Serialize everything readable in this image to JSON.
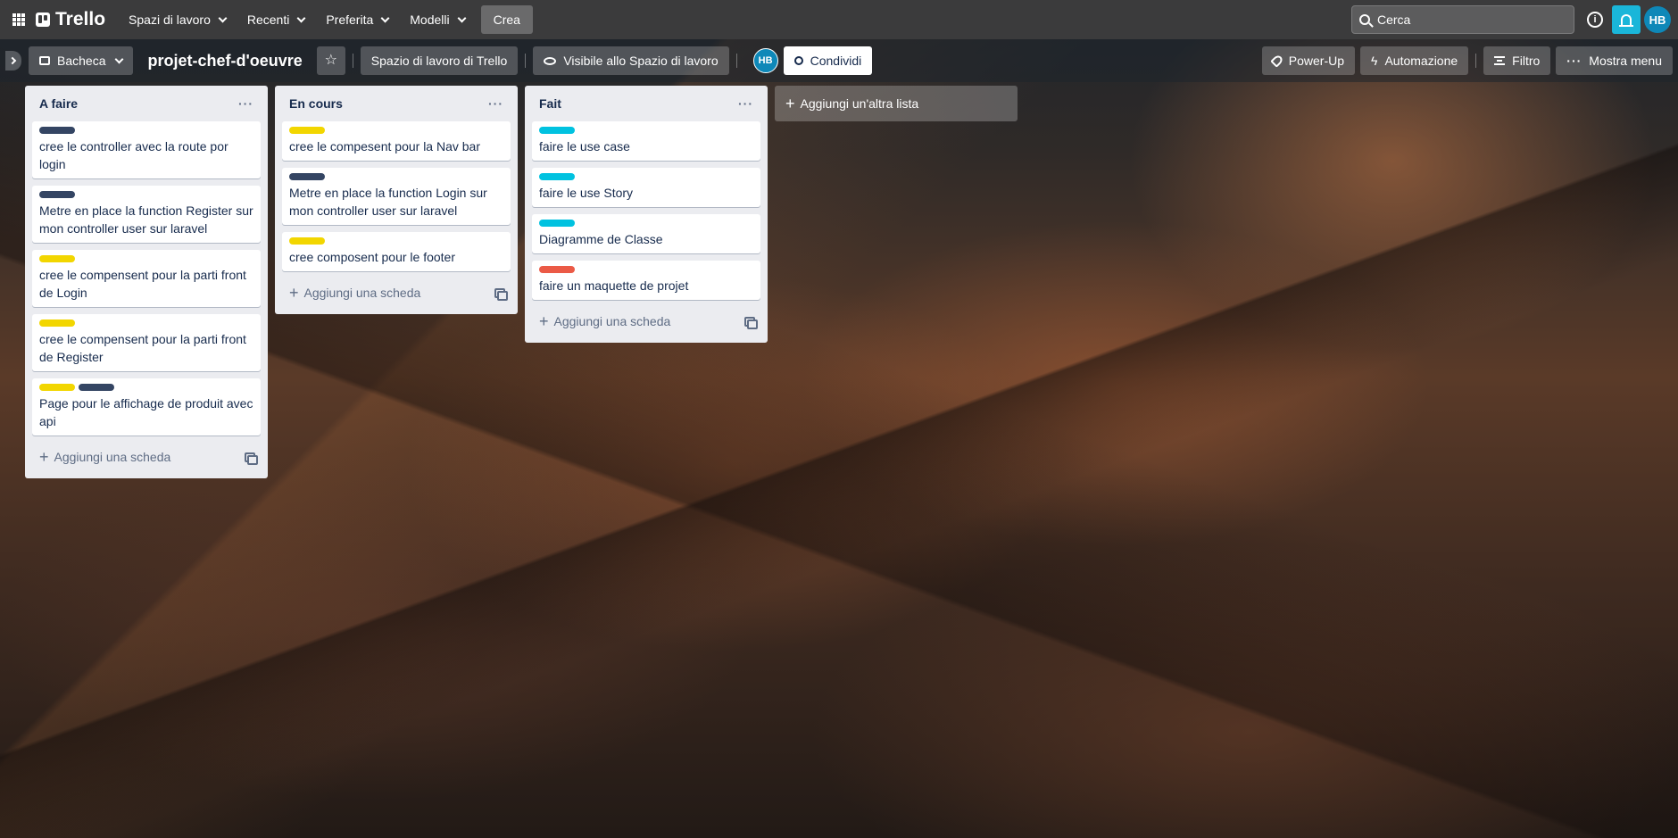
{
  "topnav": {
    "app_name": "Trello",
    "menus": [
      {
        "label": "Spazi di lavoro"
      },
      {
        "label": "Recenti"
      },
      {
        "label": "Preferita"
      },
      {
        "label": "Modelli"
      }
    ],
    "create_label": "Crea",
    "search_placeholder": "Cerca",
    "info_glyph": "i",
    "avatar_initials": "HB"
  },
  "boardbar": {
    "view_label": "Bacheca",
    "board_title": "projet-chef-d'oeuvre",
    "star_glyph": "☆",
    "workspace_label": "Spazio di lavoro di Trello",
    "visibility_label": "Visibile allo Spazio di lavoro",
    "member_initials": "HB",
    "share_label": "Condividi",
    "powerup_label": "Power-Up",
    "automation_label": "Automazione",
    "automation_glyph": "ϟ",
    "filter_label": "Filtro",
    "menu_label": "Mostra menu",
    "menu_dots": "···"
  },
  "label_colors": {
    "dark": "#344563",
    "yellow": "#f2d600",
    "cyan": "#00c2e0",
    "red": "#eb5a46"
  },
  "lists": [
    {
      "title": "A faire",
      "menu": "···",
      "add_card_label": "Aggiungi una scheda",
      "cards": [
        {
          "labels": [
            "dark"
          ],
          "text": "cree le controller avec la route por login"
        },
        {
          "labels": [
            "dark"
          ],
          "text": "Metre en place la function Register sur mon controller user sur laravel"
        },
        {
          "labels": [
            "yellow"
          ],
          "text": "cree le compensent pour la parti front de Login"
        },
        {
          "labels": [
            "yellow"
          ],
          "text": "cree le compensent pour la parti front de Register"
        },
        {
          "labels": [
            "yellow",
            "dark"
          ],
          "text": "Page pour le affichage de produit avec api"
        }
      ]
    },
    {
      "title": "En cours",
      "menu": "···",
      "add_card_label": "Aggiungi una scheda",
      "cards": [
        {
          "labels": [
            "yellow"
          ],
          "text": "cree le compesent pour la Nav bar"
        },
        {
          "labels": [
            "dark"
          ],
          "text": "Metre en place la function Login sur mon controller user sur laravel"
        },
        {
          "labels": [
            "yellow"
          ],
          "text": "cree composent pour le footer"
        }
      ]
    },
    {
      "title": "Fait",
      "menu": "···",
      "add_card_label": "Aggiungi una scheda",
      "cards": [
        {
          "labels": [
            "cyan"
          ],
          "text": "faire le use case"
        },
        {
          "labels": [
            "cyan"
          ],
          "text": "faire le use Story"
        },
        {
          "labels": [
            "cyan"
          ],
          "text": "Diagramme de Classe"
        },
        {
          "labels": [
            "red"
          ],
          "text": "faire un maquette de projet"
        }
      ]
    }
  ],
  "add_list_label": "Aggiungi un'altra lista"
}
